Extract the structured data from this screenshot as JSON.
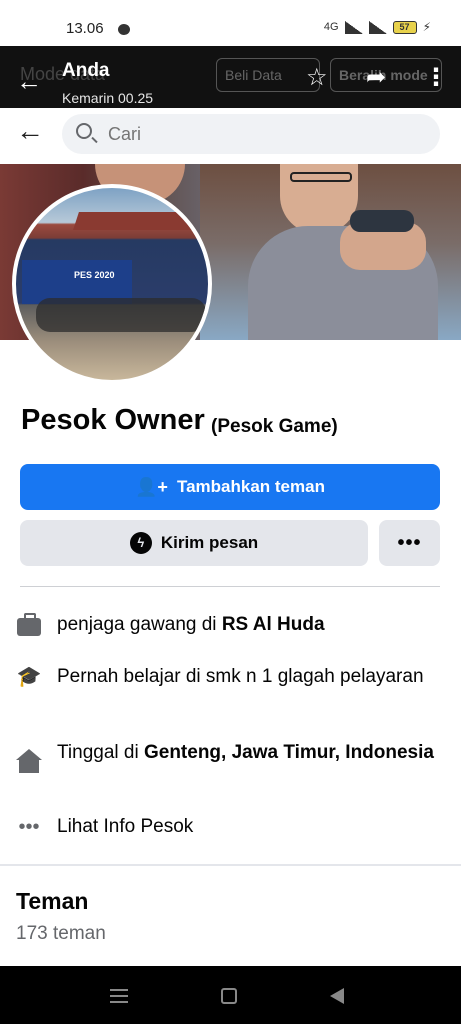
{
  "status_bar": {
    "time": "13.06",
    "network": "4G",
    "battery": "57"
  },
  "viewer_header": {
    "ghost_title": "Mode data",
    "title": "Anda",
    "subtitle": "Kemarin 00.25",
    "pill_buy": "Beli Data",
    "pill_switch": "Beralih mode",
    "icons": [
      "back-arrow-icon",
      "star-icon",
      "share-icon",
      "more-vertical-icon"
    ]
  },
  "search": {
    "placeholder": "Cari"
  },
  "profile": {
    "name": "Pesok Owner",
    "alt_name": "(Pesok Game)",
    "avatar_banner_text": "PES 2020"
  },
  "actions": {
    "add_friend": "Tambahkan teman",
    "send_message": "Kirim pesan",
    "more": "•••"
  },
  "intro": {
    "work_prefix": "penjaga gawang di ",
    "work_place": "RS Al Huda",
    "education": "Pernah belajar di smk n 1 glagah pelayaran",
    "lives_prefix": "Tinggal di ",
    "lives_place": "Genteng, Jawa Timur, Indonesia",
    "see_info": "Lihat Info Pesok"
  },
  "friends": {
    "title": "Teman",
    "count": "173 teman"
  },
  "colors": {
    "primary": "#1877f2",
    "secondary_button": "#e4e6eb",
    "muted_text": "#65676b",
    "overlay_header": "#111111"
  }
}
